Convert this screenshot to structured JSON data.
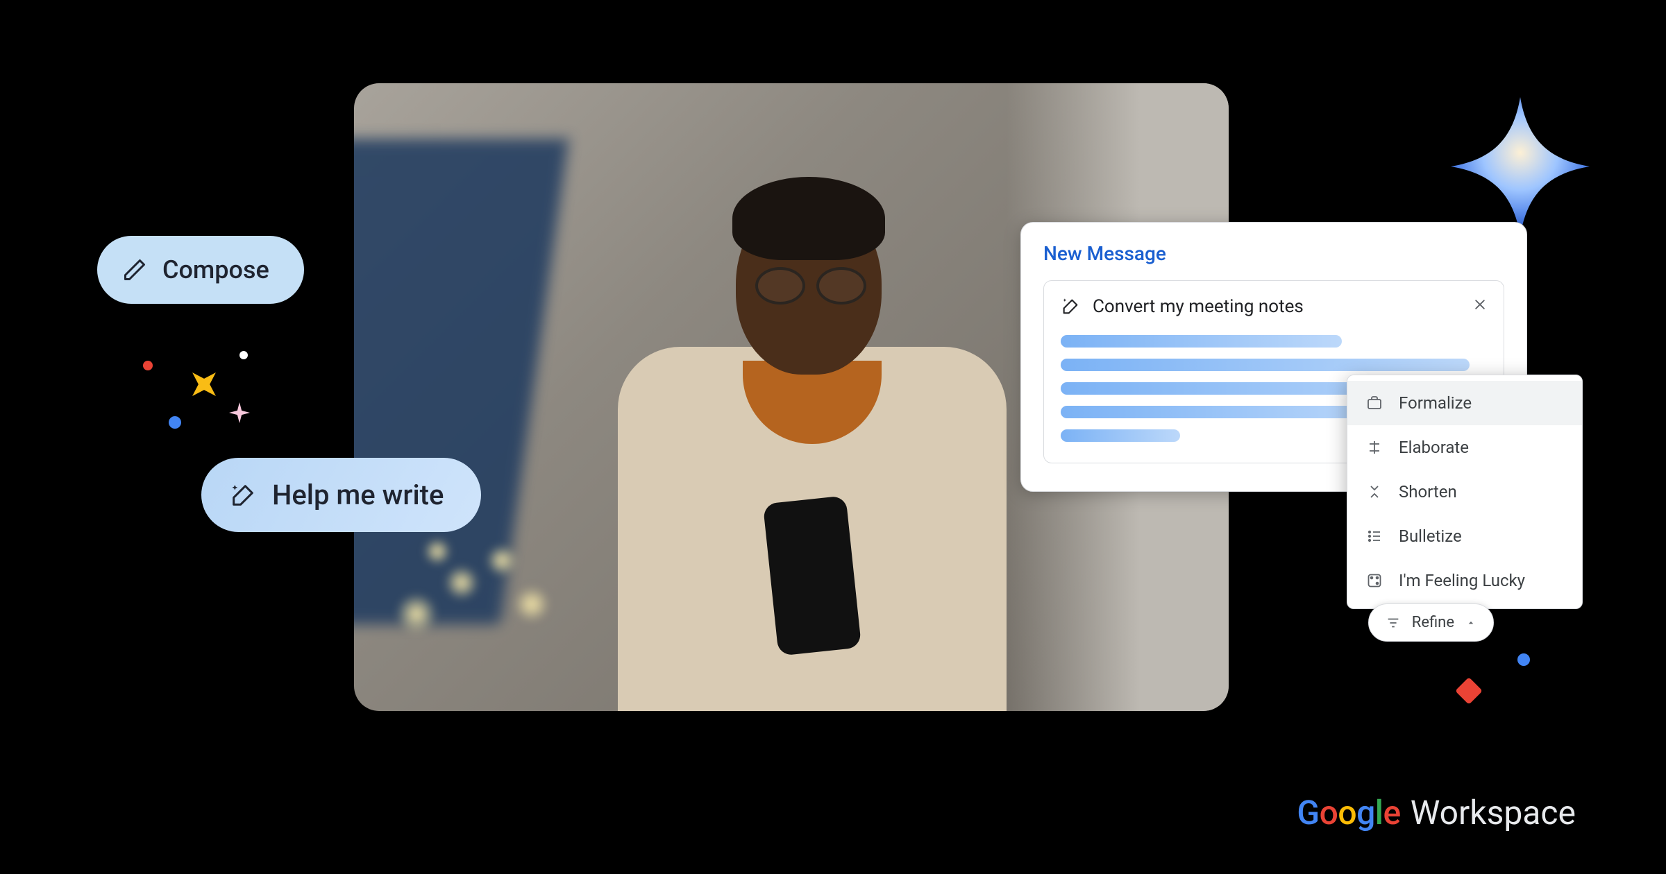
{
  "pills": {
    "compose_label": "Compose",
    "help_label": "Help me write"
  },
  "panel": {
    "title": "New Message",
    "prompt": "Convert my meeting notes"
  },
  "refine": {
    "chip_label": "Refine",
    "options": {
      "formalize": "Formalize",
      "elaborate": "Elaborate",
      "shorten": "Shorten",
      "bulletize": "Bulletize",
      "lucky": "I'm Feeling Lucky"
    }
  },
  "brand": {
    "google": "Google",
    "workspace": "Workspace"
  },
  "colors": {
    "panel_title": "#1a5fd0",
    "pill_compose_bg": "#c5e0f6"
  }
}
